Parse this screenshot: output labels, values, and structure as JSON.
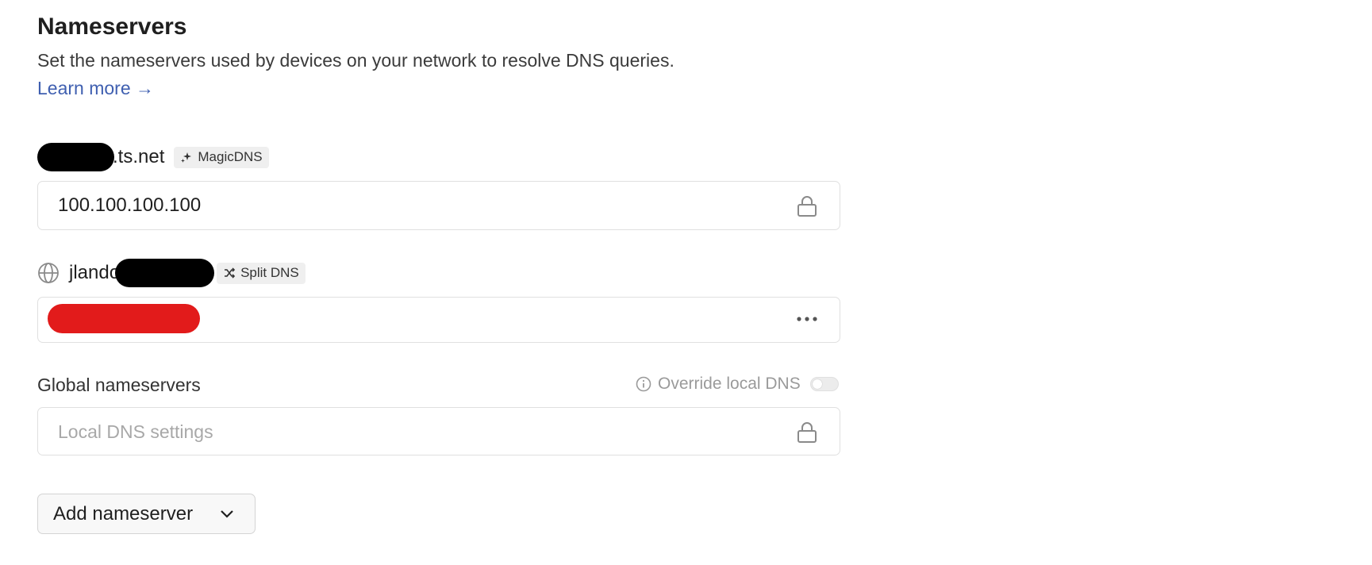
{
  "section": {
    "title": "Nameservers",
    "description": "Set the nameservers used by devices on your network to resolve DNS queries.",
    "learn_more": "Learn more →"
  },
  "magicdns": {
    "domain_suffix": ".ts.net",
    "badge": "MagicDNS",
    "value": "100.100.100.100"
  },
  "splitdns": {
    "domain_prefix": "jlando",
    "badge": "Split DNS"
  },
  "global": {
    "label": "Global nameservers",
    "override_label": "Override local DNS",
    "override_enabled": false,
    "placeholder": "Local DNS settings"
  },
  "add_button": {
    "label": "Add nameserver"
  },
  "colors": {
    "link": "#3f5fb0",
    "redact_red": "#e21b1b"
  }
}
